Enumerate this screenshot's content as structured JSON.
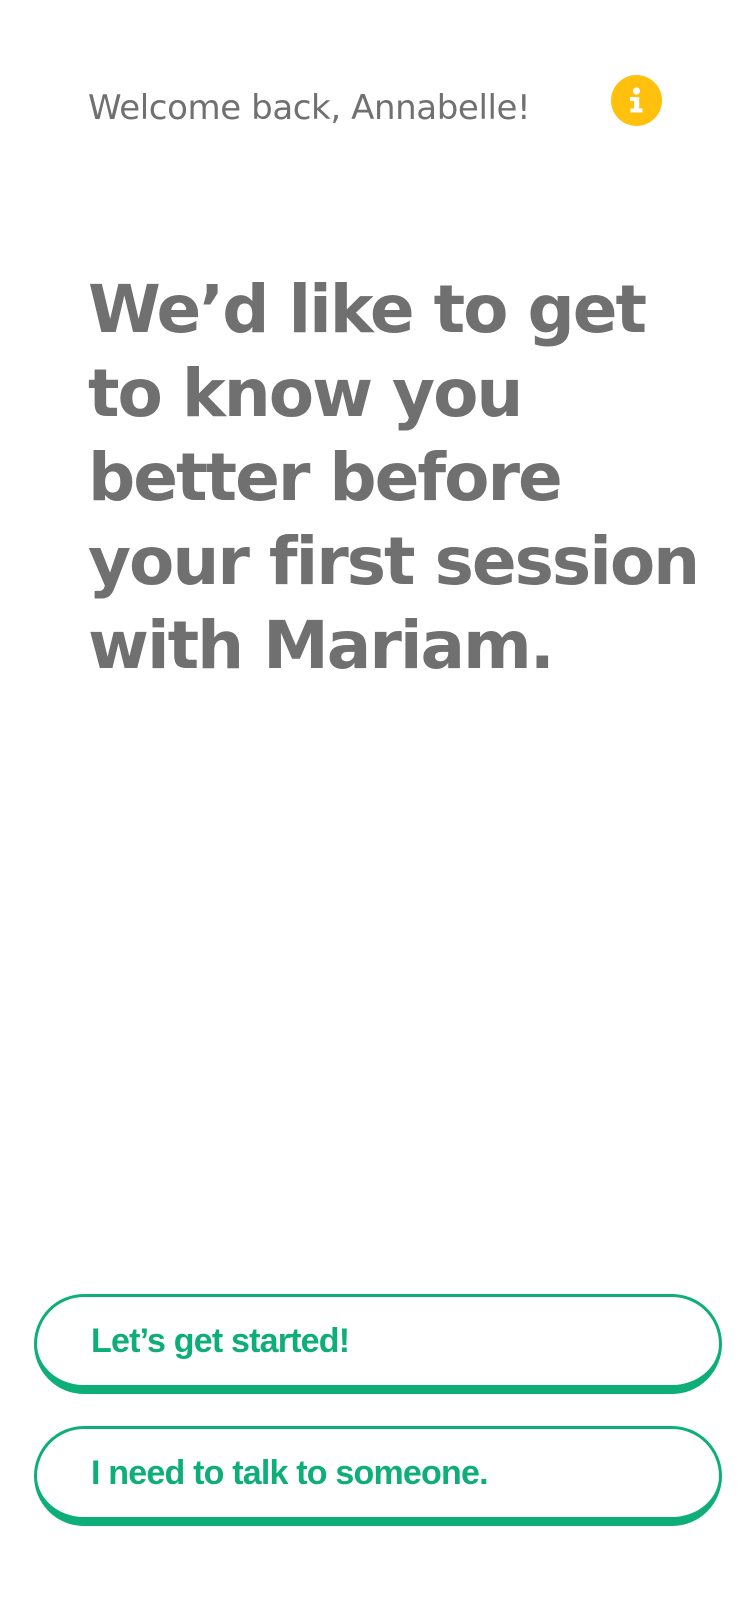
{
  "header": {
    "greeting": "Welcome back, Annabelle!",
    "info_icon": "info-icon",
    "info_color": "#FFC10E"
  },
  "main": {
    "headline_lines": [
      "We’d like to get",
      "to know you",
      "better before",
      "your first session",
      "with Mariam."
    ]
  },
  "actions": {
    "start_label": "Let’s get started!",
    "talk_label": "I need to talk to someone.",
    "accent_color": "#0EAE79"
  },
  "text_color": "#707070"
}
